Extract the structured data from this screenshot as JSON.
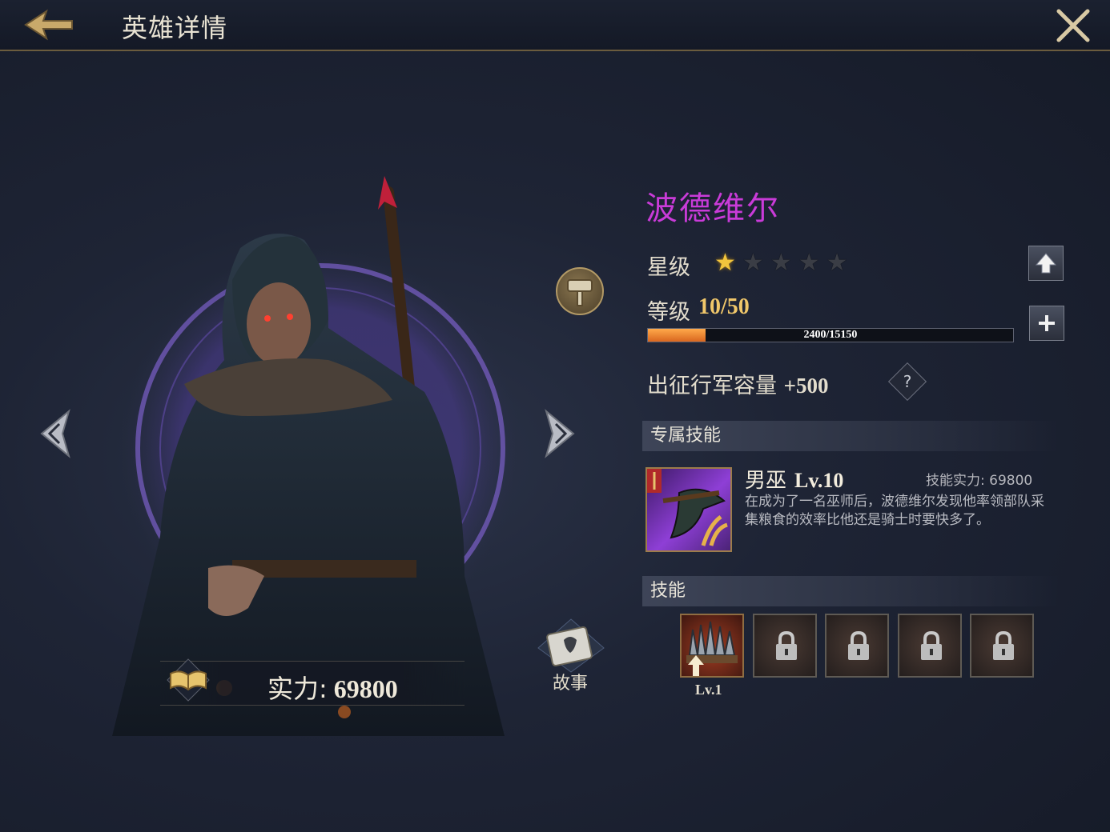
{
  "header": {
    "title": "英雄详情"
  },
  "hero": {
    "name": "波德维尔",
    "power_label": "实力:",
    "power_value": "69800",
    "story_label": "故事"
  },
  "stats": {
    "star_label": "星级",
    "stars_filled": 1,
    "stars_total": 5,
    "level_label": "等级",
    "level_value": "10/50",
    "exp_text": "2400/15150",
    "exp_current": 2400,
    "exp_max": 15150,
    "capacity_label": "出征行军容量",
    "capacity_value": "+500",
    "help_symbol": "?"
  },
  "exclusive_skill": {
    "header": "专属技能",
    "name": "男巫",
    "level": "Lv.10",
    "power": "技能实力: 69800",
    "description": "在成为了一名巫师后，波德维尔发现他率领部队采集粮食的效率比他还是骑士时要快多了。"
  },
  "skills": {
    "header": "技能",
    "first_level": "Lv.1",
    "slots": [
      "unlocked",
      "locked",
      "locked",
      "locked",
      "locked"
    ]
  },
  "colors": {
    "hero_name": "#c93bd8",
    "star_on": "#f2c53d",
    "exp_fill": "#e07425",
    "gold_text": "#f0c76a"
  }
}
